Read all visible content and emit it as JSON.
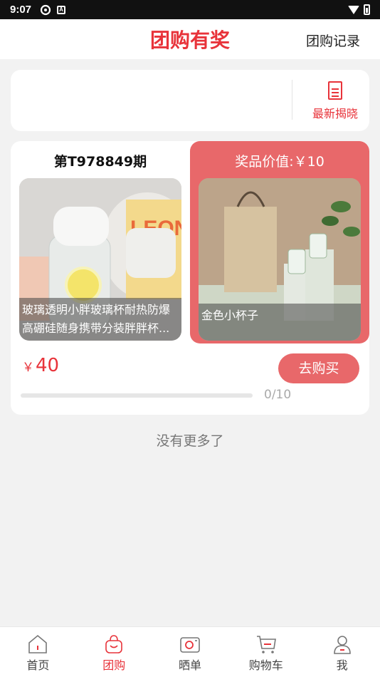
{
  "status_bar": {
    "time": "9:07",
    "a_icon": "A"
  },
  "header": {
    "title": "团购有奖",
    "record_label": "团购记录"
  },
  "reveal": {
    "label": "最新揭晓",
    "icon": "document-icon"
  },
  "group": {
    "period": "第T978849期",
    "prize_value": "奖品价值:￥10",
    "product_caption_line1": "玻璃透明小胖玻璃杯耐热防爆",
    "product_caption_line2": "高硼硅随身携带分装胖胖杯...",
    "prize_caption": "金色小杯子",
    "currency": "￥",
    "price": "40",
    "buy_label": "去购买",
    "progress_text": "0/10",
    "progress_fraction": 0
  },
  "footer_note": "没有更多了",
  "nav": [
    {
      "label": "首页",
      "icon": "home-icon"
    },
    {
      "label": "团购",
      "icon": "bag-icon"
    },
    {
      "label": "晒单",
      "icon": "camera-icon"
    },
    {
      "label": "购物车",
      "icon": "cart-icon"
    },
    {
      "label": "我",
      "icon": "user-icon"
    }
  ],
  "colors": {
    "accent": "#e8333a",
    "prize_panel": "#e8686a"
  }
}
